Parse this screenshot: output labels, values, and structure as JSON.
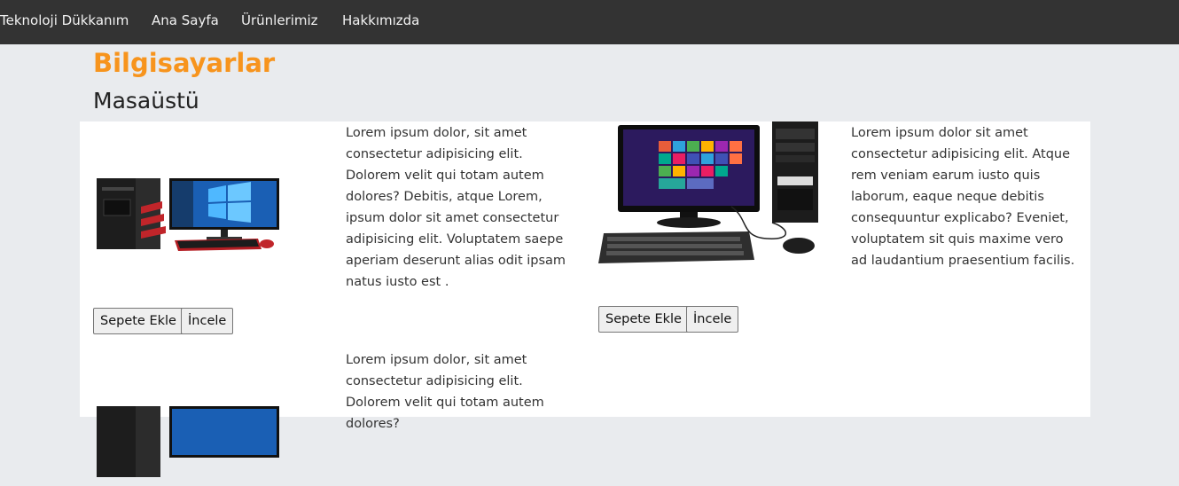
{
  "nav": {
    "brand": "Teknoloji Dükkanım",
    "links": [
      "Ana Sayfa",
      "Ürünlerimiz",
      "Hakkımızda"
    ]
  },
  "page": {
    "category_title": "Bilgisayarlar",
    "subcategory_title": "Masaüstü"
  },
  "products": [
    {
      "image": "desktop-pc-with-red-accents-and-windows-10-monitor",
      "description": "Lorem ipsum dolor, sit amet consectetur adipisicing elit. Dolorem velit qui totam autem dolores? Debitis, atque Lorem, ipsum dolor sit amet consectetur adipisicing elit. Voluptatem saepe aperiam deserunt alias odit ipsam natus iusto est .",
      "add_to_cart": "Sepete Ekle",
      "inspect": "İncele"
    },
    {
      "image": "desktop-pc-tower-with-windows-8-monitor-keyboard-mouse",
      "description": "Lorem ipsum dolor sit amet consectetur adipisicing elit. Atque rem veniam earum iusto quis laborum, eaque neque debitis consequuntur explicabo? Eveniet, voluptatem sit quis maxime vero ad laudantium praesentium facilis.",
      "add_to_cart": "Sepete Ekle",
      "inspect": "İncele"
    },
    {
      "image": "desktop-pc-with-red-accents-and-windows-10-monitor",
      "description": "Lorem ipsum dolor, sit amet consectetur adipisicing elit. Dolorem velit qui totam autem dolores?"
    }
  ],
  "colors": {
    "navbar": "#333333",
    "category_title": "#f7941d",
    "page_background": "#e9ebee"
  }
}
